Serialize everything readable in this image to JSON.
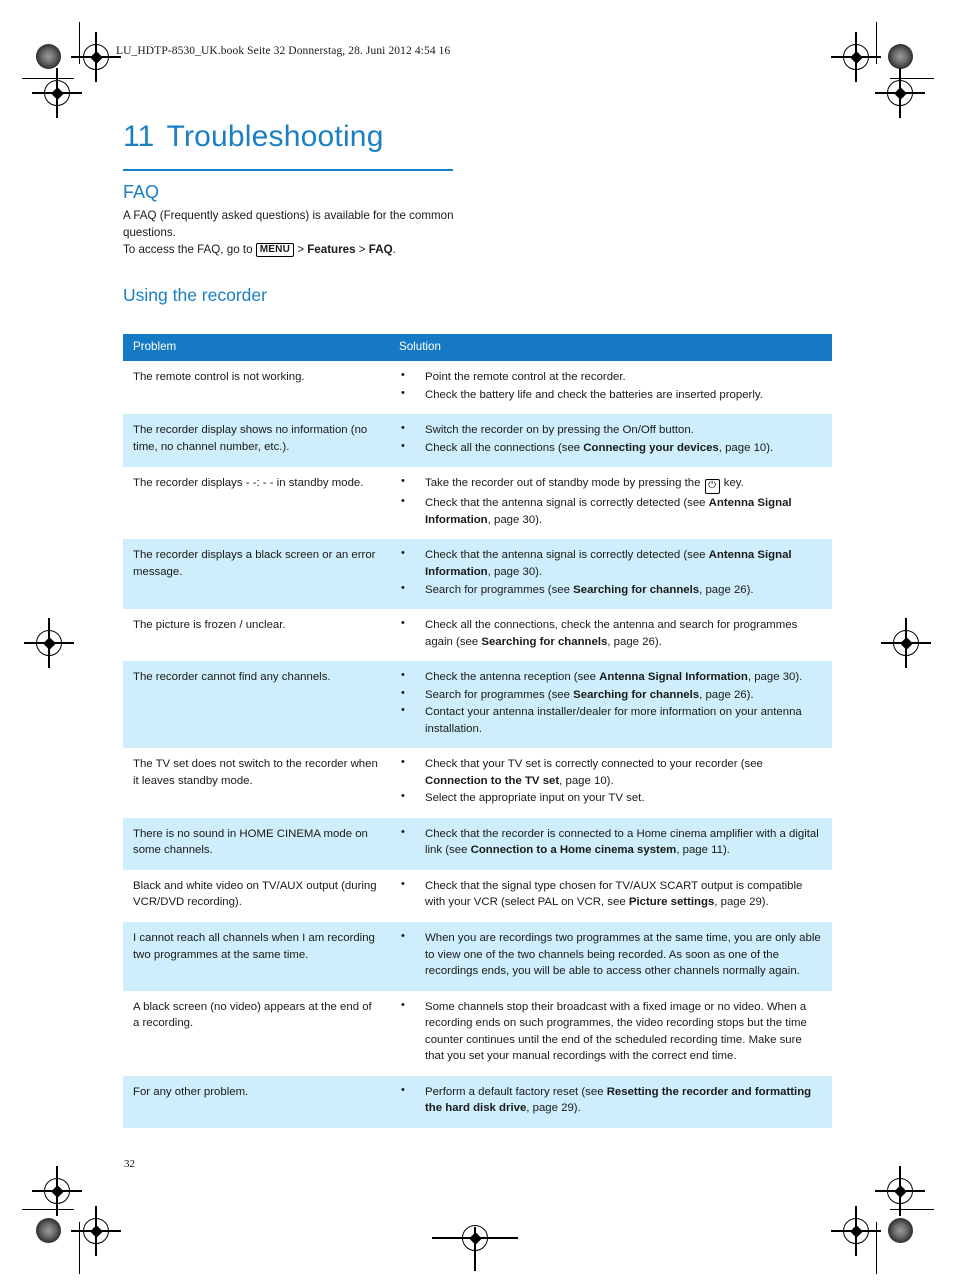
{
  "page": {
    "running_header": "LU_HDTP-8530_UK.book  Seite 32  Donnerstag, 28. Juni 2012  4:54 16",
    "folio": "32",
    "accent_color": "#1b7fc4",
    "table_header_color": "#1679c4",
    "table_alt_row_color": "#cdeefa"
  },
  "chapter": {
    "number": "11",
    "title": "Troubleshooting"
  },
  "faq": {
    "heading": "FAQ",
    "paragraph_line1": "A FAQ (Frequently asked questions) is available for the common",
    "paragraph_line2": "questions.",
    "access_prefix": "To access the FAQ, go to ",
    "menu_key": "MENU",
    "sep1": " > ",
    "path_item1": "Features",
    "sep2": " > ",
    "path_item2": "FAQ",
    "period": "."
  },
  "section": {
    "heading": "Using the recorder"
  },
  "table": {
    "columns": [
      "Problem",
      "Solution"
    ],
    "rows": [
      {
        "shaded": false,
        "problem": "The remote control is not working.",
        "solutions": [
          [
            {
              "t": "Point the remote control at the recorder."
            }
          ],
          [
            {
              "t": "Check the battery life and check the batteries are inserted properly."
            }
          ]
        ]
      },
      {
        "shaded": true,
        "problem": "The recorder display shows no information (no time, no channel number, etc.).",
        "solutions": [
          [
            {
              "t": "Switch the recorder on by pressing the On/Off button."
            }
          ],
          [
            {
              "t": "Check all the connections (see "
            },
            {
              "t": "Connecting your devices",
              "b": true
            },
            {
              "t": ", page 10)."
            }
          ]
        ]
      },
      {
        "shaded": false,
        "problem": "The recorder displays - -: - - in standby mode.",
        "solutions": [
          [
            {
              "t": "Take the recorder out of standby mode by pressing the "
            },
            {
              "key": "⏻"
            },
            {
              "t": " key."
            }
          ],
          [
            {
              "t": "Check that the antenna signal is correctly detected (see "
            },
            {
              "t": "Antenna Signal Information",
              "b": true
            },
            {
              "t": ", page 30)."
            }
          ]
        ]
      },
      {
        "shaded": true,
        "problem": "The recorder displays a black screen or an error message.",
        "solutions": [
          [
            {
              "t": "Check that the antenna signal is correctly detected (see "
            },
            {
              "t": "Antenna Signal Information",
              "b": true
            },
            {
              "t": ", page 30)."
            }
          ],
          [
            {
              "t": "Search for programmes (see "
            },
            {
              "t": "Searching for channels",
              "b": true
            },
            {
              "t": ", page 26)."
            }
          ]
        ]
      },
      {
        "shaded": false,
        "problem": "The picture is frozen / unclear.",
        "solutions": [
          [
            {
              "t": "Check all the connections, check the antenna and search for programmes again (see "
            },
            {
              "t": "Searching for channels",
              "b": true
            },
            {
              "t": ", page 26)."
            }
          ]
        ]
      },
      {
        "shaded": true,
        "problem": "The recorder cannot find any channels.",
        "solutions": [
          [
            {
              "t": "Check the antenna reception (see "
            },
            {
              "t": "Antenna Signal Information",
              "b": true
            },
            {
              "t": ", page 30)."
            }
          ],
          [
            {
              "t": "Search for programmes (see "
            },
            {
              "t": "Searching for channels",
              "b": true
            },
            {
              "t": ", page 26)."
            }
          ],
          [
            {
              "t": "Contact your antenna installer/dealer for more information on your antenna installation."
            }
          ]
        ]
      },
      {
        "shaded": false,
        "problem": "The TV set does not switch to the recorder when it leaves standby mode.",
        "solutions": [
          [
            {
              "t": "Check that your TV set is correctly connected to your recorder (see "
            },
            {
              "t": "Connection to the TV set",
              "b": true
            },
            {
              "t": ", page 10)."
            }
          ],
          [
            {
              "t": "Select the appropriate input on your TV set."
            }
          ]
        ]
      },
      {
        "shaded": true,
        "problem": "There is no sound in HOME CINEMA mode on some channels.",
        "solutions": [
          [
            {
              "t": "Check that the recorder is connected to a Home cinema amplifier with a digital link (see "
            },
            {
              "t": "Connection to a Home cinema system",
              "b": true
            },
            {
              "t": ", page 11)."
            }
          ]
        ]
      },
      {
        "shaded": false,
        "problem": "Black and white video on TV/AUX output (during VCR/DVD recording).",
        "solutions": [
          [
            {
              "t": "Check that the signal type chosen for TV/AUX SCART output is compatible with your VCR (select PAL on VCR, see "
            },
            {
              "t": "Picture settings",
              "b": true
            },
            {
              "t": ", page 29)."
            }
          ]
        ]
      },
      {
        "shaded": true,
        "problem": "I cannot reach all channels when I am recording two programmes at the same time.",
        "solutions": [
          [
            {
              "t": "When you are recordings two programmes at the same time, you are only able to view one of the two channels being recorded. As soon as one of the recordings ends, you will be able to access other channels normally again."
            }
          ]
        ]
      },
      {
        "shaded": false,
        "problem": "A black screen (no video) appears at the end of a recording.",
        "solutions": [
          [
            {
              "t": "Some channels stop their broadcast with a fixed image or no video. When a recording ends on such programmes, the video recording stops but the time counter continues until the end of the scheduled recording time. Make sure that you set your manual recordings with the correct end time."
            }
          ]
        ]
      },
      {
        "shaded": true,
        "problem": "For any other problem.",
        "solutions": [
          [
            {
              "t": "Perform a default factory reset (see "
            },
            {
              "t": "Resetting the recorder and formatting the hard disk drive",
              "b": true
            },
            {
              "t": ", page 29)."
            }
          ]
        ]
      }
    ]
  }
}
